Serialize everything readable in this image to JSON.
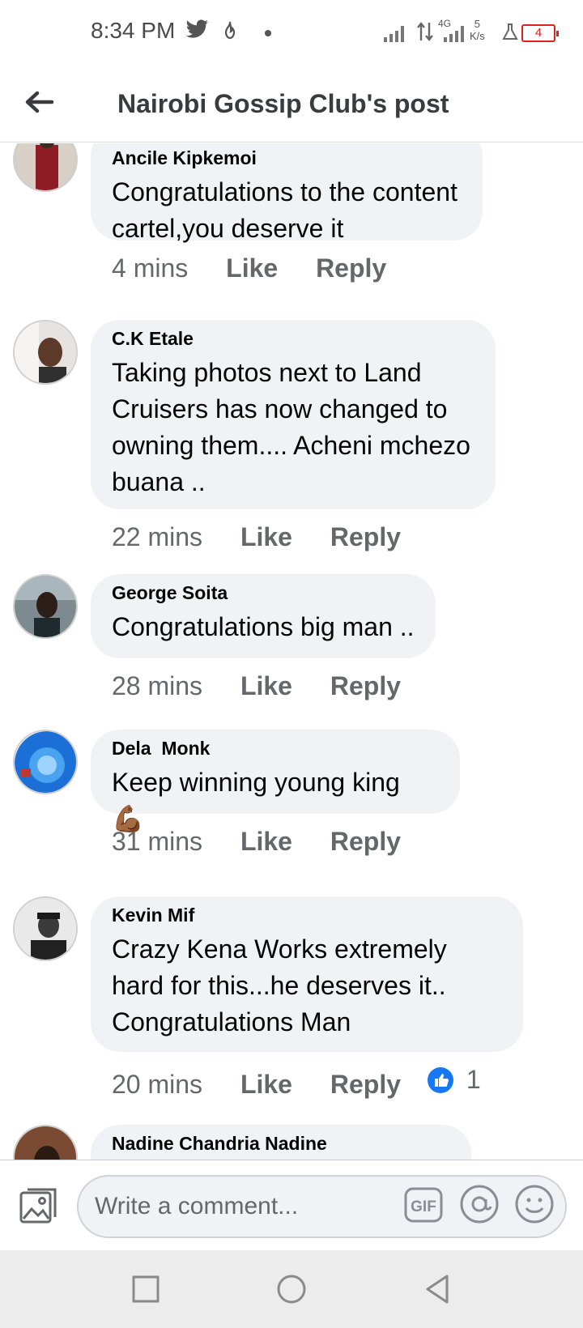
{
  "status_bar": {
    "time": "8:34 PM",
    "network_type": "4G",
    "speed_value": "5",
    "speed_unit": "K/s",
    "battery": "4",
    "icons": [
      "twitter-icon",
      "flame-icon",
      "signal-icon",
      "data-arrows-icon",
      "flask-icon",
      "battery-icon"
    ]
  },
  "header": {
    "title": "Nairobi Gossip Club's post"
  },
  "comments": [
    {
      "name": "Ancile Kipkemoi",
      "text": "Congratulations to the content cartel,you deserve it",
      "time": "4 mins",
      "like": "Like",
      "reply": "Reply"
    },
    {
      "name": "C.K Etale",
      "text": "Taking photos next to Land Cruisers has now changed to owning them.... Acheni mchezo buana ..",
      "time": "22 mins",
      "like": "Like",
      "reply": "Reply"
    },
    {
      "name": "George Soita",
      "text": "Congratulations big man ..",
      "time": "28 mins",
      "like": "Like",
      "reply": "Reply"
    },
    {
      "name": "Dela  Monk",
      "text": "Keep winning young king 💪🏾",
      "time": "31 mins",
      "like": "Like",
      "reply": "Reply"
    },
    {
      "name": "Kevin Mif",
      "text": "Crazy Kena Works extremely hard for this...he deserves it.. Congratulations Man",
      "time": "20 mins",
      "like": "Like",
      "reply": "Reply",
      "reaction_count": "1"
    },
    {
      "name": "Nadine Chandria Nadine"
    }
  ],
  "composer": {
    "placeholder": "Write a comment..."
  },
  "colors": {
    "bubble": "#f0f2f5",
    "like_reaction": "#1877f2",
    "battery_low": "#e02020"
  }
}
